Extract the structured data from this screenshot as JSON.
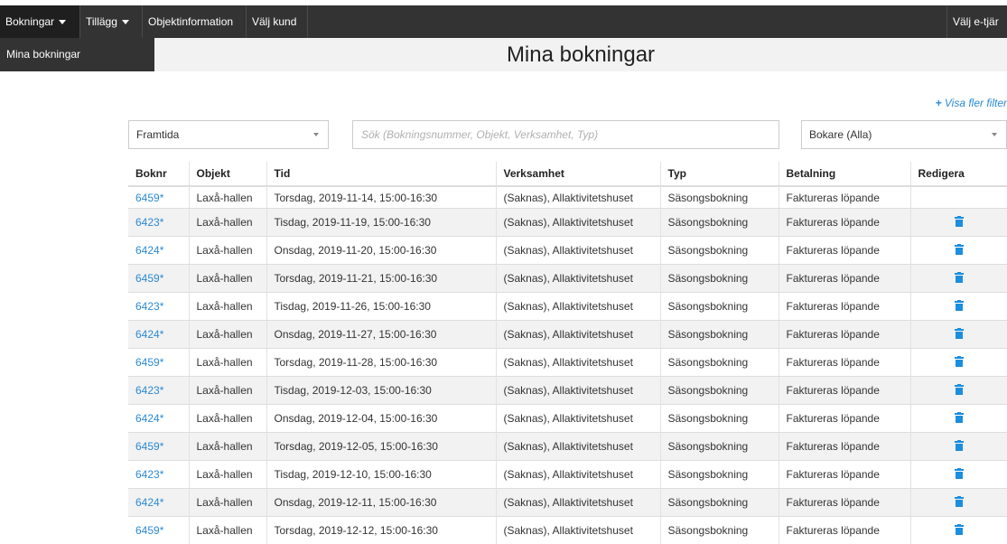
{
  "nav": {
    "items": [
      {
        "label": "Bokningar",
        "caret": true
      },
      {
        "label": "Tillägg",
        "caret": true
      },
      {
        "label": "Objektinformation",
        "caret": false
      },
      {
        "label": "Välj kund",
        "caret": false
      }
    ],
    "right_label": "Välj e-tjär"
  },
  "submenu": {
    "label": "Mina bokningar"
  },
  "page": {
    "title": "Mina bokningar"
  },
  "filters": {
    "more_filters_label": "Visa fler filter",
    "period_select": "Framtida",
    "search_placeholder": "Sök (Bokningsnummer, Objekt, Verksamhet, Typ)",
    "booker_select": "Bokare (Alla)"
  },
  "table": {
    "headers": [
      "Boknr",
      "Objekt",
      "Tid",
      "Verksamhet",
      "Typ",
      "Betalning",
      "Redigera"
    ],
    "rows": [
      {
        "nr": "6459*",
        "objekt": "Laxå-hallen",
        "tid": "Torsdag, 2019-11-14, 15:00-16:30",
        "verksamhet": "(Saknas), Allaktivitetshuset",
        "typ": "Säsongsbokning",
        "betalning": "Faktureras löpande",
        "editable": false
      },
      {
        "nr": "6423*",
        "objekt": "Laxå-hallen",
        "tid": "Tisdag, 2019-11-19, 15:00-16:30",
        "verksamhet": "(Saknas), Allaktivitetshuset",
        "typ": "Säsongsbokning",
        "betalning": "Faktureras löpande",
        "editable": true
      },
      {
        "nr": "6424*",
        "objekt": "Laxå-hallen",
        "tid": "Onsdag, 2019-11-20, 15:00-16:30",
        "verksamhet": "(Saknas), Allaktivitetshuset",
        "typ": "Säsongsbokning",
        "betalning": "Faktureras löpande",
        "editable": true
      },
      {
        "nr": "6459*",
        "objekt": "Laxå-hallen",
        "tid": "Torsdag, 2019-11-21, 15:00-16:30",
        "verksamhet": "(Saknas), Allaktivitetshuset",
        "typ": "Säsongsbokning",
        "betalning": "Faktureras löpande",
        "editable": true
      },
      {
        "nr": "6423*",
        "objekt": "Laxå-hallen",
        "tid": "Tisdag, 2019-11-26, 15:00-16:30",
        "verksamhet": "(Saknas), Allaktivitetshuset",
        "typ": "Säsongsbokning",
        "betalning": "Faktureras löpande",
        "editable": true
      },
      {
        "nr": "6424*",
        "objekt": "Laxå-hallen",
        "tid": "Onsdag, 2019-11-27, 15:00-16:30",
        "verksamhet": "(Saknas), Allaktivitetshuset",
        "typ": "Säsongsbokning",
        "betalning": "Faktureras löpande",
        "editable": true
      },
      {
        "nr": "6459*",
        "objekt": "Laxå-hallen",
        "tid": "Torsdag, 2019-11-28, 15:00-16:30",
        "verksamhet": "(Saknas), Allaktivitetshuset",
        "typ": "Säsongsbokning",
        "betalning": "Faktureras löpande",
        "editable": true
      },
      {
        "nr": "6423*",
        "objekt": "Laxå-hallen",
        "tid": "Tisdag, 2019-12-03, 15:00-16:30",
        "verksamhet": "(Saknas), Allaktivitetshuset",
        "typ": "Säsongsbokning",
        "betalning": "Faktureras löpande",
        "editable": true
      },
      {
        "nr": "6424*",
        "objekt": "Laxå-hallen",
        "tid": "Onsdag, 2019-12-04, 15:00-16:30",
        "verksamhet": "(Saknas), Allaktivitetshuset",
        "typ": "Säsongsbokning",
        "betalning": "Faktureras löpande",
        "editable": true
      },
      {
        "nr": "6459*",
        "objekt": "Laxå-hallen",
        "tid": "Torsdag, 2019-12-05, 15:00-16:30",
        "verksamhet": "(Saknas), Allaktivitetshuset",
        "typ": "Säsongsbokning",
        "betalning": "Faktureras löpande",
        "editable": true
      },
      {
        "nr": "6423*",
        "objekt": "Laxå-hallen",
        "tid": "Tisdag, 2019-12-10, 15:00-16:30",
        "verksamhet": "(Saknas), Allaktivitetshuset",
        "typ": "Säsongsbokning",
        "betalning": "Faktureras löpande",
        "editable": true
      },
      {
        "nr": "6424*",
        "objekt": "Laxå-hallen",
        "tid": "Onsdag, 2019-12-11, 15:00-16:30",
        "verksamhet": "(Saknas), Allaktivitetshuset",
        "typ": "Säsongsbokning",
        "betalning": "Faktureras löpande",
        "editable": true
      },
      {
        "nr": "6459*",
        "objekt": "Laxå-hallen",
        "tid": "Torsdag, 2019-12-12, 15:00-16:30",
        "verksamhet": "(Saknas), Allaktivitetshuset",
        "typ": "Säsongsbokning",
        "betalning": "Faktureras löpande",
        "editable": true
      }
    ]
  },
  "icons": {
    "edit": "trash-icon",
    "add_filter": "plus-icon"
  },
  "colors": {
    "nav_bg": "#333333",
    "link": "#2a8ad4",
    "trash": "#1a8ee0",
    "row_alt": "#f2f2f2"
  }
}
